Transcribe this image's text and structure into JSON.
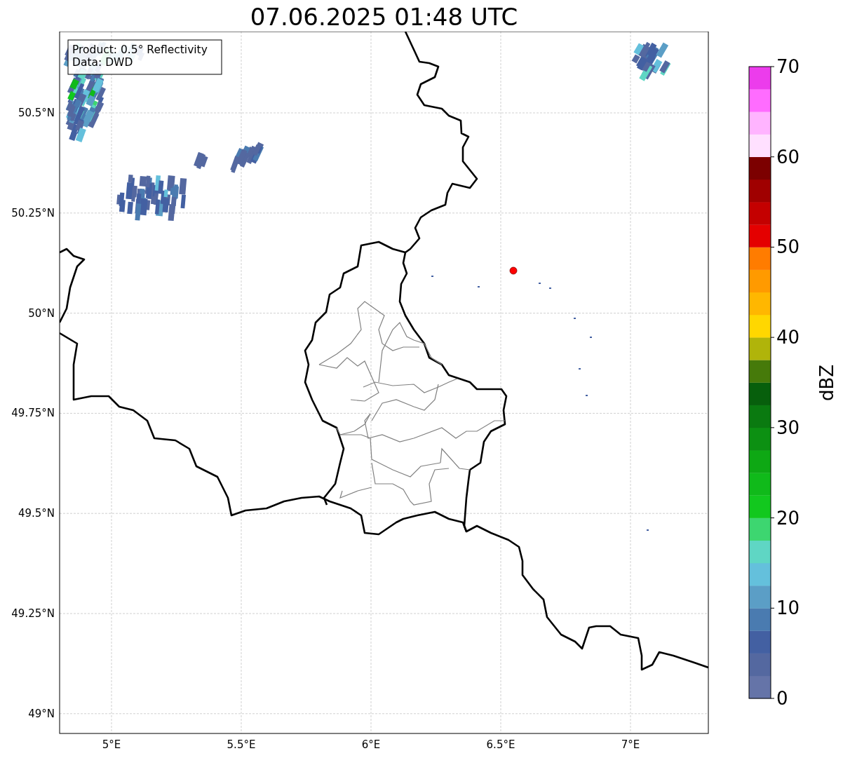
{
  "title": "07.06.2025 01:48 UTC",
  "info_box": [
    "Product: 0.5° Reflectivity",
    "Data: DWD"
  ],
  "map": {
    "lat_labels": [
      "50.5°N",
      "50.25°N",
      "50°N",
      "49.75°N",
      "49.5°N",
      "49.25°N",
      "49°N"
    ],
    "lon_labels": [
      "5°E",
      "5.5°E",
      "6°E",
      "6.5°E",
      "7°E"
    ]
  },
  "colorbar": {
    "label": "dBZ",
    "ticks": [
      "70",
      "60",
      "50",
      "40",
      "30",
      "20",
      "10",
      "0"
    ],
    "bands": [
      {
        "color": "#6574a8"
      },
      {
        "color": "#5468a0"
      },
      {
        "color": "#4360a2"
      },
      {
        "color": "#4a7bb0"
      },
      {
        "color": "#5b9ec6"
      },
      {
        "color": "#64c0dc"
      },
      {
        "color": "#5fd6c4"
      },
      {
        "color": "#3dd670"
      },
      {
        "color": "#12c81e"
      },
      {
        "color": "#10ba1a"
      },
      {
        "color": "#0ea814"
      },
      {
        "color": "#0c9012"
      },
      {
        "color": "#0a7a10"
      },
      {
        "color": "#075f0c"
      },
      {
        "color": "#467a0a"
      },
      {
        "color": "#b0b40a"
      },
      {
        "color": "#ffd700"
      },
      {
        "color": "#ffb700"
      },
      {
        "color": "#ff9a00"
      },
      {
        "color": "#ff7c00"
      },
      {
        "color": "#e40000"
      },
      {
        "color": "#c40000"
      },
      {
        "color": "#a00000"
      },
      {
        "color": "#7c0000"
      },
      {
        "color": "#ffe0ff"
      },
      {
        "color": "#ffb4ff"
      },
      {
        "color": "#ff6cff"
      },
      {
        "color": "#ec3cec"
      }
    ]
  }
}
